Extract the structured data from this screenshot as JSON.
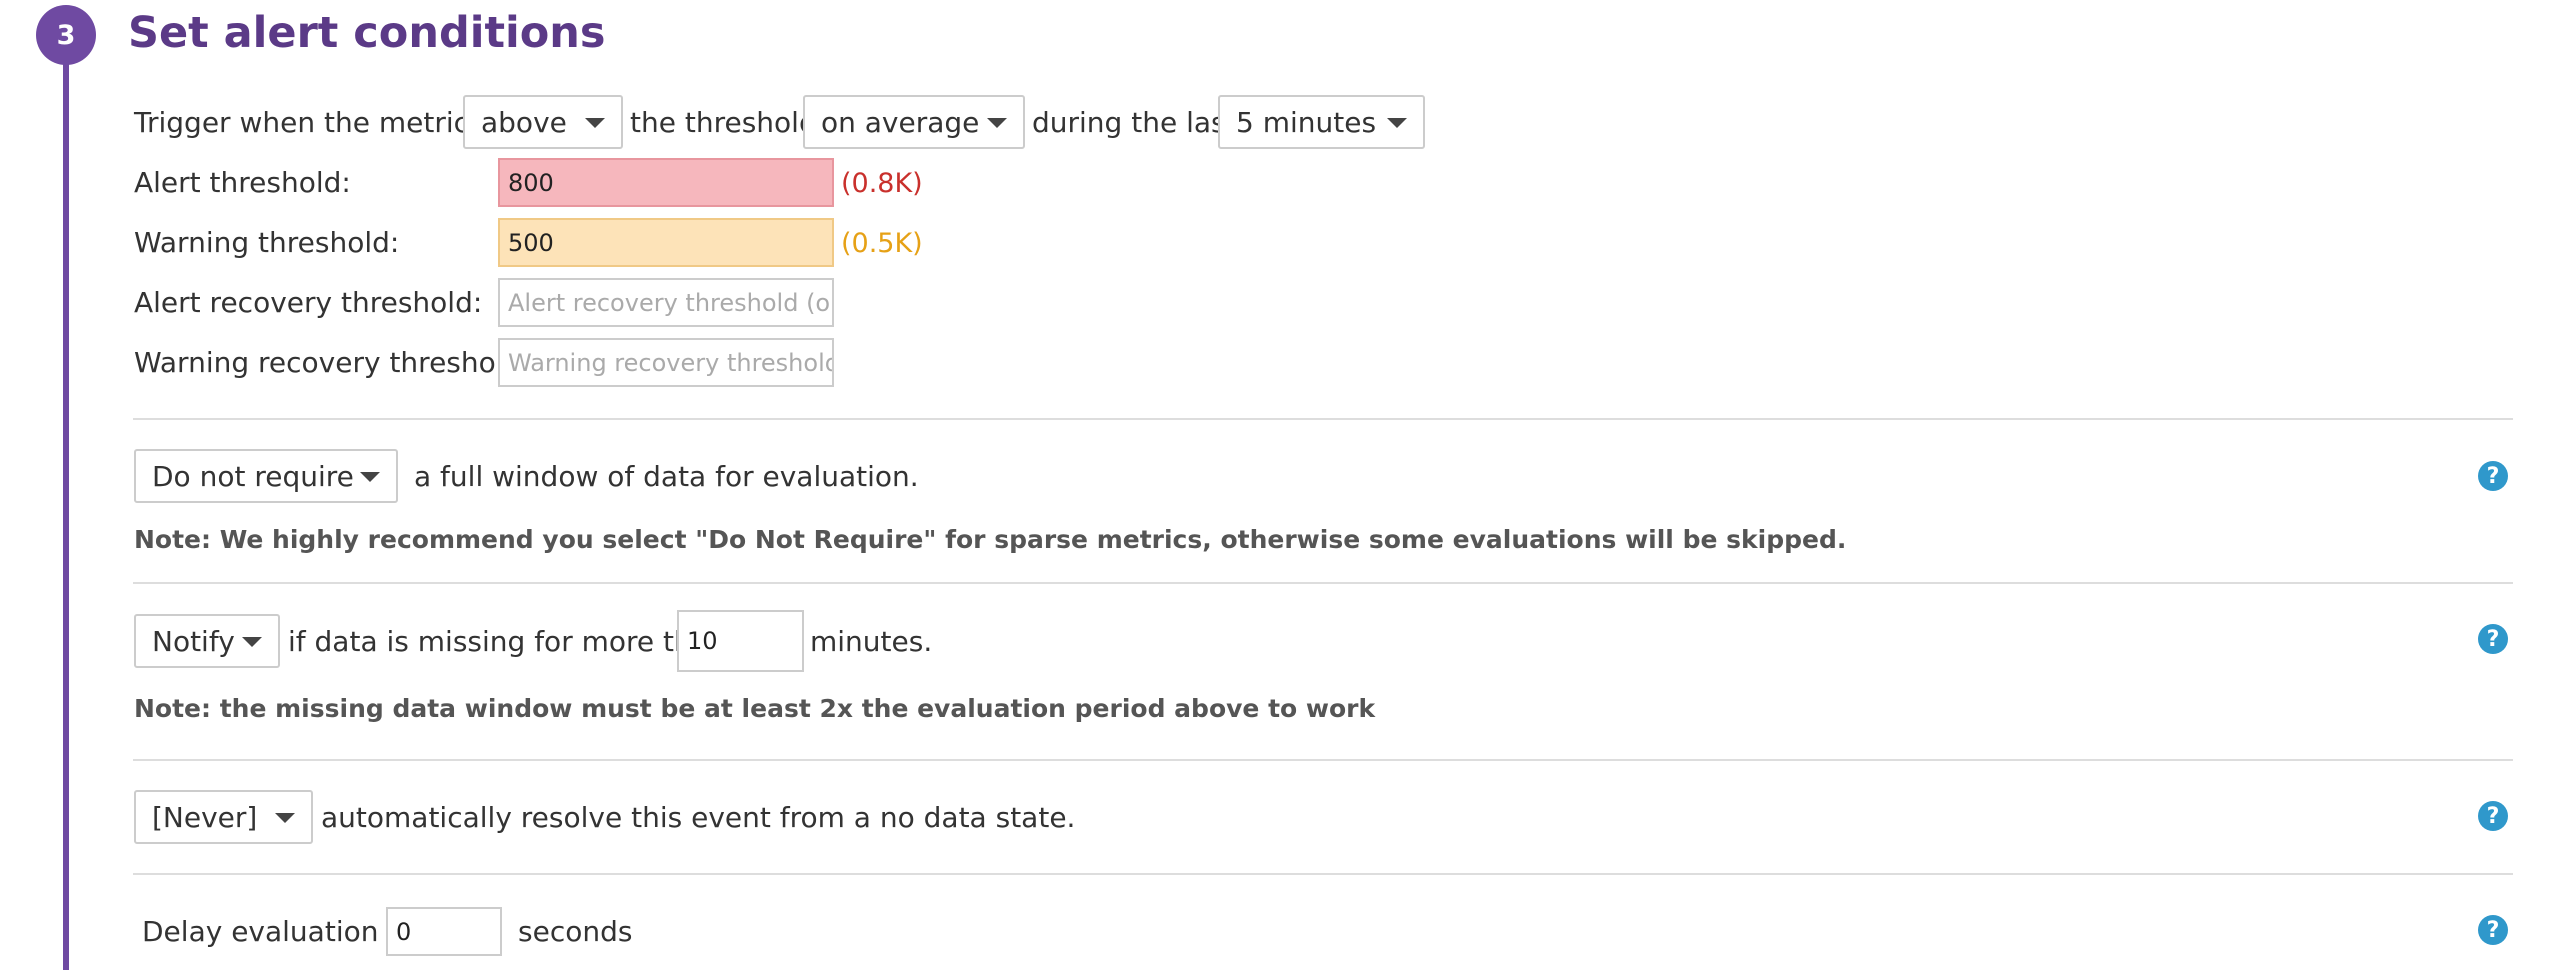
{
  "section": {
    "step_number": "3",
    "title": "Set alert conditions"
  },
  "trigger": {
    "prefix": "Trigger when the metric is",
    "comparator": "above",
    "middle": "the threshold",
    "aggregation": "on average",
    "during": "during the last",
    "window": "5 minutes"
  },
  "thresholds": {
    "alert_label": "Alert threshold:",
    "alert_value": "800",
    "alert_display": "(0.8K)",
    "warning_label": "Warning threshold:",
    "warning_value": "500",
    "warning_display": "(0.5K)",
    "alert_recovery_label": "Alert recovery threshold:",
    "alert_recovery_placeholder": "Alert recovery threshold (opt",
    "warning_recovery_label": "Warning recovery threshold:",
    "warning_recovery_placeholder": "Warning recovery threshold"
  },
  "full_window": {
    "option": "Do not require",
    "text": "a full window of data for evaluation.",
    "note": "Note: We highly recommend you select \"Do Not Require\" for sparse metrics, otherwise some evaluations will be skipped."
  },
  "missing_data": {
    "option": "Notify",
    "text_before": "if data is missing for more than",
    "minutes_value": "10",
    "text_after": "minutes.",
    "note": "Note: the missing data window must be at least 2x the evaluation period above to work"
  },
  "auto_resolve": {
    "option": "[Never]",
    "text": "automatically resolve this event from a no data state."
  },
  "delay": {
    "text_before": "Delay evaluation by",
    "value": "0",
    "text_after": "seconds"
  },
  "help_icon_glyph": "?",
  "colors": {
    "accent_purple": "#6f4aa2",
    "alert_bg": "#f6b7bd",
    "warning_bg": "#fde3b8",
    "help_blue": "#2f98cb"
  }
}
